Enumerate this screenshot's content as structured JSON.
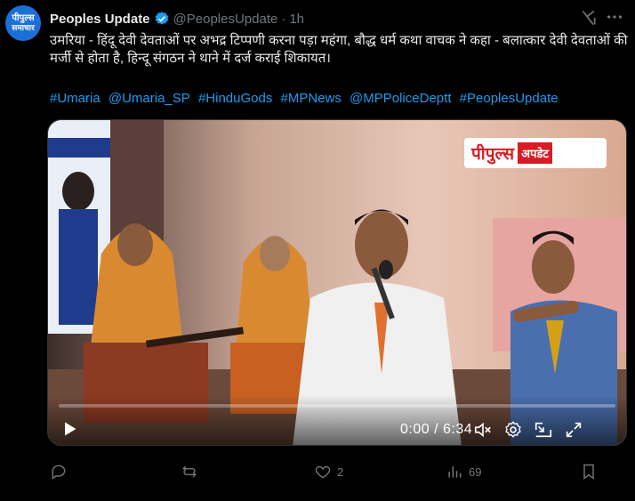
{
  "post": {
    "author_name": "Peoples Update",
    "handle": "@PeoplesUpdate",
    "separator": "·",
    "time": "1h",
    "avatar_line1": "पीपुल्स",
    "avatar_line2": "समाचार",
    "text": "उमरिया - हिंदू देवी देवताओं पर अभद्र टिप्पणी करना पड़ा महंगा, बौद्ध धर्म कथा वाचक ने कहा - बलात्कार देवी देवताओं की मर्जी से होता है, हिन्दू संगठन ने थाने में दर्ज कराई शिकायत।",
    "hashtags": [
      "#Umaria",
      "@Umaria_SP",
      "#HinduGods",
      "#MPNews",
      "@MPPoliceDeptt",
      "#PeoplesUpdate"
    ]
  },
  "video": {
    "badge_main": "पीपुल्स",
    "badge_sub": "अपडेट",
    "time_display": "0:00 / 6:34",
    "progress": 0
  },
  "actions": {
    "replies": "",
    "reposts": "",
    "likes": "2",
    "views": "69"
  },
  "colors": {
    "accent": "#1d9bf0",
    "text": "#e7e9ea",
    "muted": "#71767b",
    "background": "#000000"
  }
}
